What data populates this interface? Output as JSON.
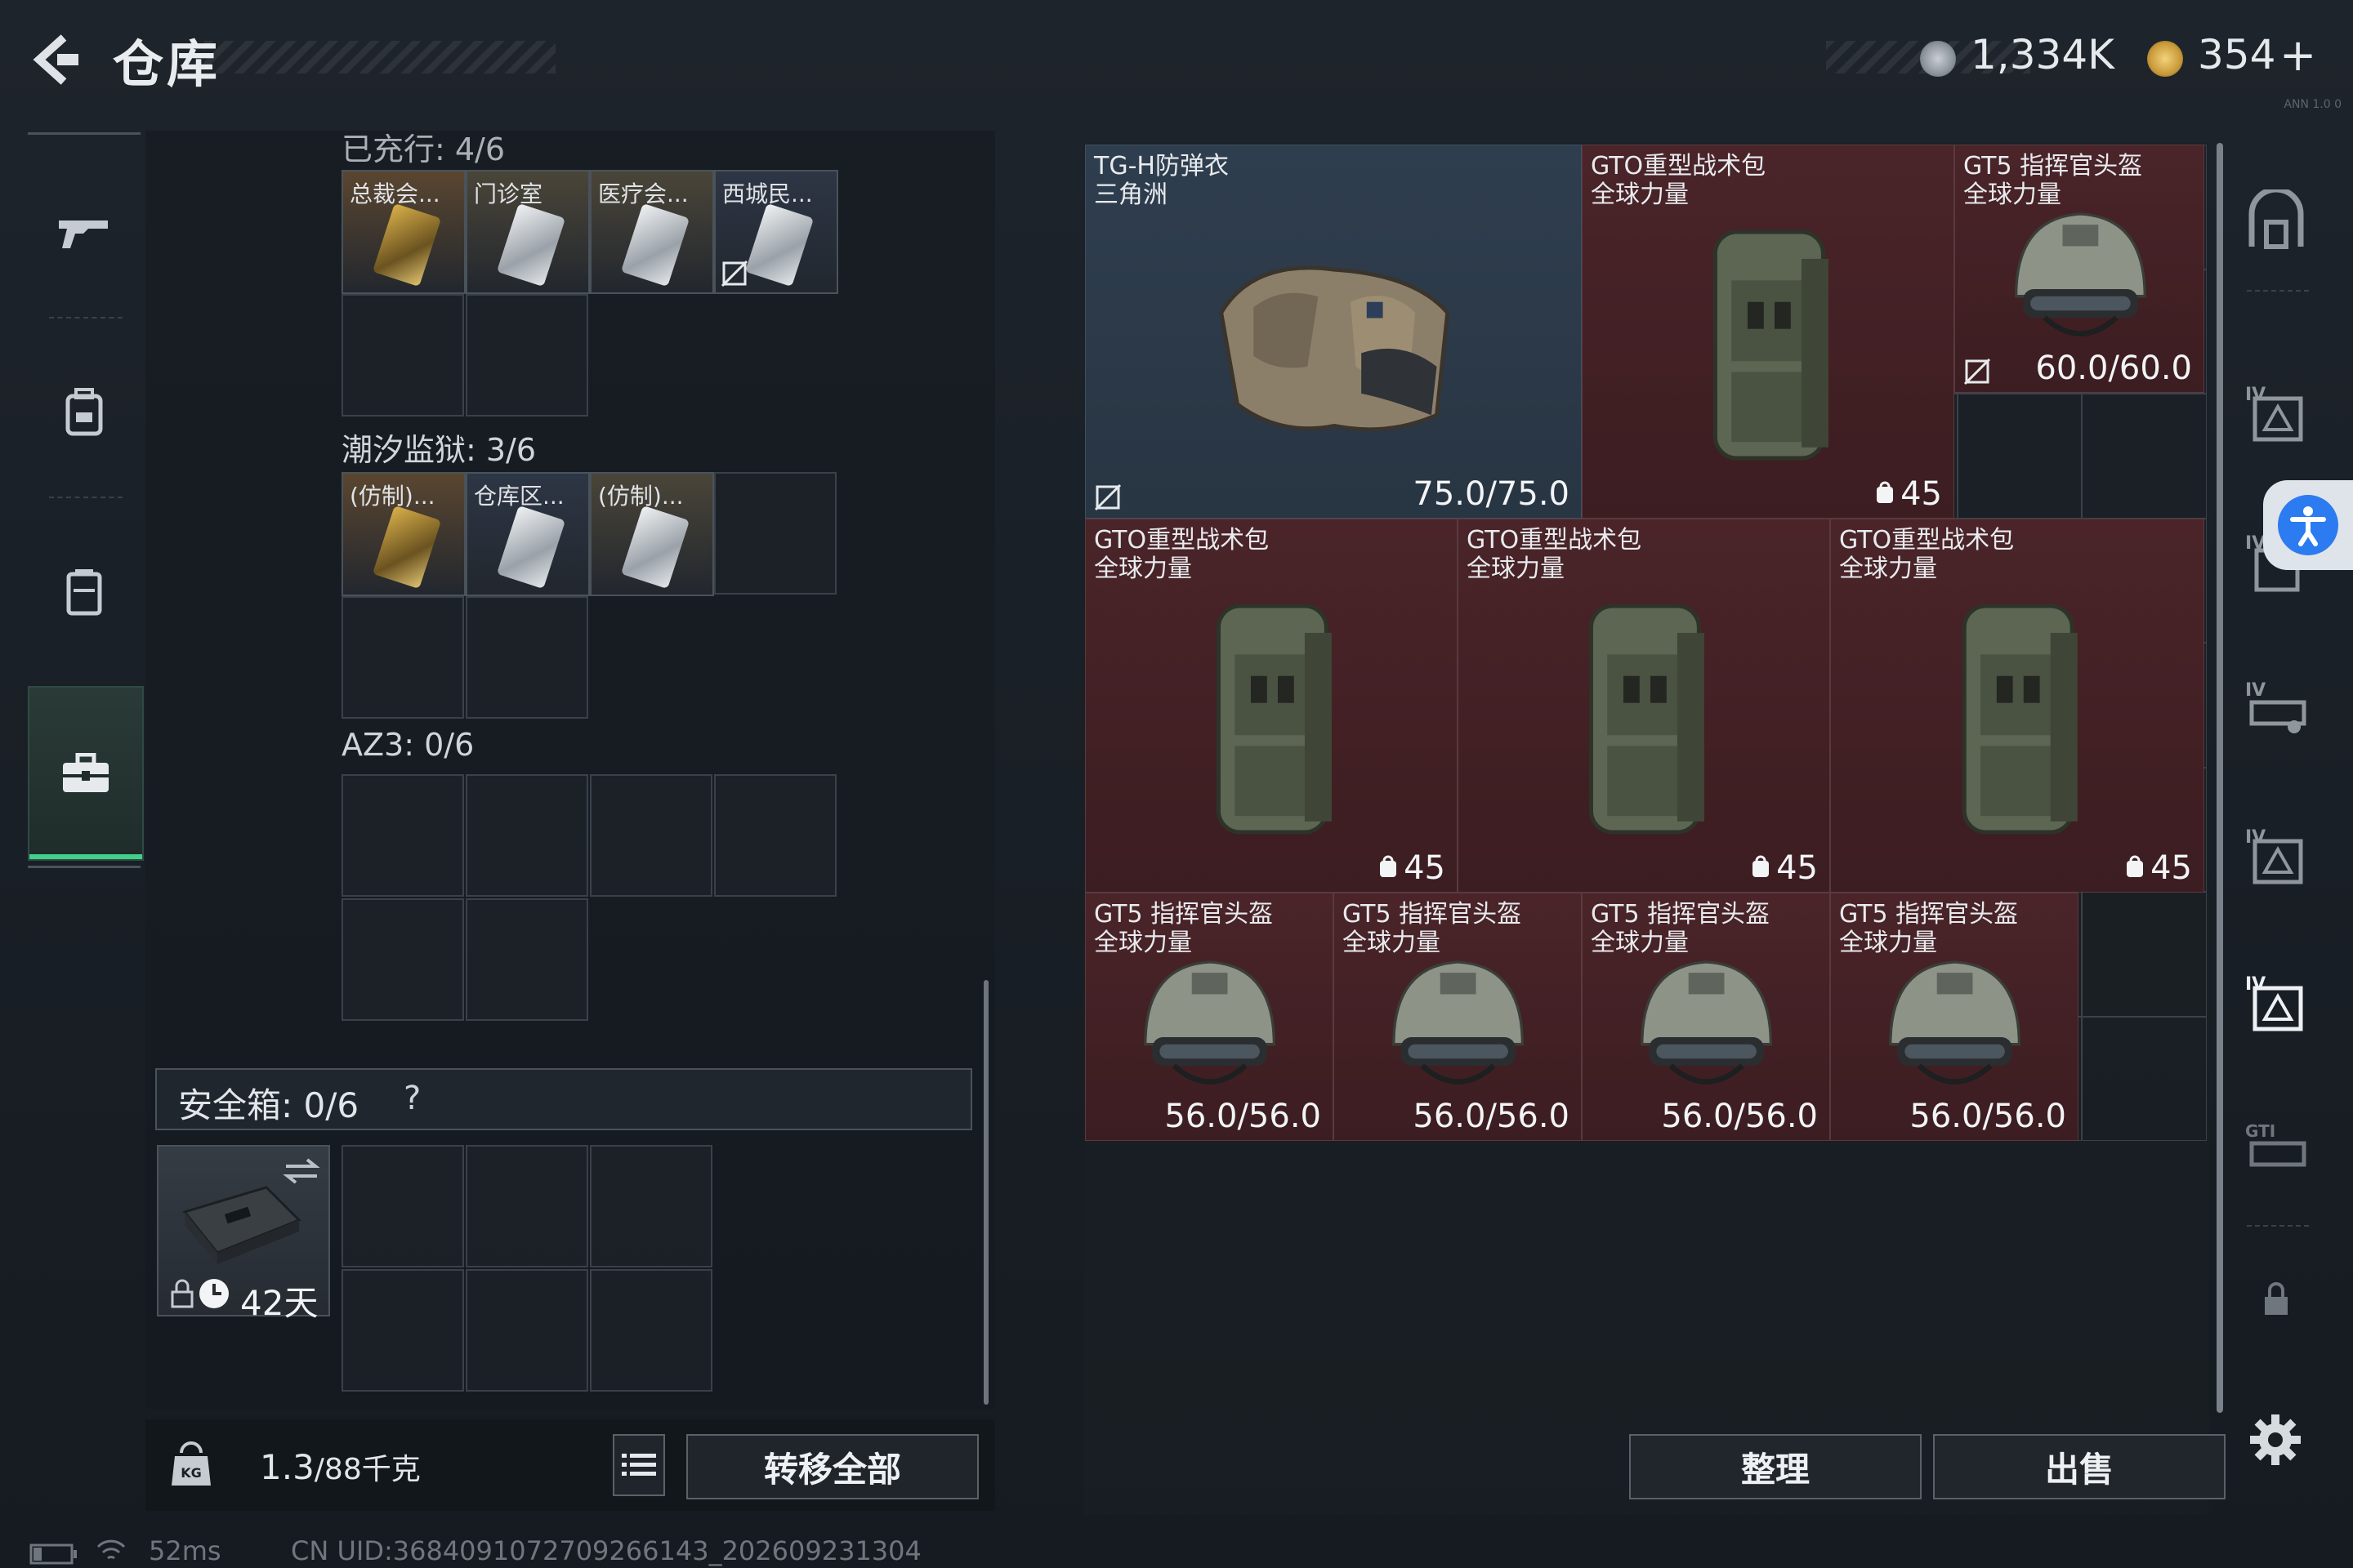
{
  "header": {
    "title": "仓库",
    "currency1": "1,334K",
    "currency2": "354",
    "add_symbol": "+",
    "version_text": "ANN 1.0 0"
  },
  "left_nav": {
    "items": [
      "weapon-icon",
      "backpack-icon",
      "vest-icon",
      "toolbox-icon"
    ],
    "active_index": 3
  },
  "storage": {
    "top_section_label": "已充行: 4/6",
    "top_cards": [
      {
        "label": "总裁会...",
        "color": "#5a4630"
      },
      {
        "label": "门诊室",
        "color": "#4a4538"
      },
      {
        "label": "医疗会...",
        "color": "#4a4538"
      },
      {
        "label": "西城民...",
        "color": "#2d3645"
      }
    ],
    "section2_label": "潮汐监狱: 3/6",
    "section2_cards": [
      {
        "label": "(仿制)...",
        "color": "#5a4630"
      },
      {
        "label": "仓库区...",
        "color": "#2d3645"
      },
      {
        "label": "(仿制)...",
        "color": "#4a4538"
      }
    ],
    "section3_label": "AZ3: 0/6",
    "safe_box_label": "安全箱: 0/6",
    "safe_box_help": "?",
    "case_days": "42天",
    "weight_current": "1.3",
    "weight_max": "/88千克",
    "transfer_all": "转移全部"
  },
  "grid_items": [
    {
      "name": "TG-H防弹衣",
      "sub": "三角洲",
      "value": "75.0/75.0",
      "kind": "vest"
    },
    {
      "name": "GTO重型战术包",
      "sub": "全球力量",
      "value": "45",
      "kind": "backpack"
    },
    {
      "name": "GT5 指挥官头盔",
      "sub": "全球力量",
      "value": "60.0/60.0",
      "kind": "helmet"
    },
    {
      "name": "GTO重型战术包",
      "sub": "全球力量",
      "value": "45",
      "kind": "backpack"
    },
    {
      "name": "GTO重型战术包",
      "sub": "全球力量",
      "value": "45",
      "kind": "backpack"
    },
    {
      "name": "GTO重型战术包",
      "sub": "全球力量",
      "value": "45",
      "kind": "backpack"
    },
    {
      "name": "GT5 指挥官头盔",
      "sub": "全球力量",
      "value": "56.0/56.0",
      "kind": "helmet"
    },
    {
      "name": "GT5 指挥官头盔",
      "sub": "全球力量",
      "value": "56.0/56.0",
      "kind": "helmet"
    },
    {
      "name": "GT5 指挥官头盔",
      "sub": "全球力量",
      "value": "56.0/56.0",
      "kind": "helmet"
    },
    {
      "name": "GT5 指挥官头盔",
      "sub": "全球力量",
      "value": "56.0/56.0",
      "kind": "helmet"
    }
  ],
  "actions": {
    "sort": "整理",
    "sell": "出售"
  },
  "status": {
    "ping": "52ms",
    "uid": "CN UID:3684091072709266143_202609231304"
  }
}
